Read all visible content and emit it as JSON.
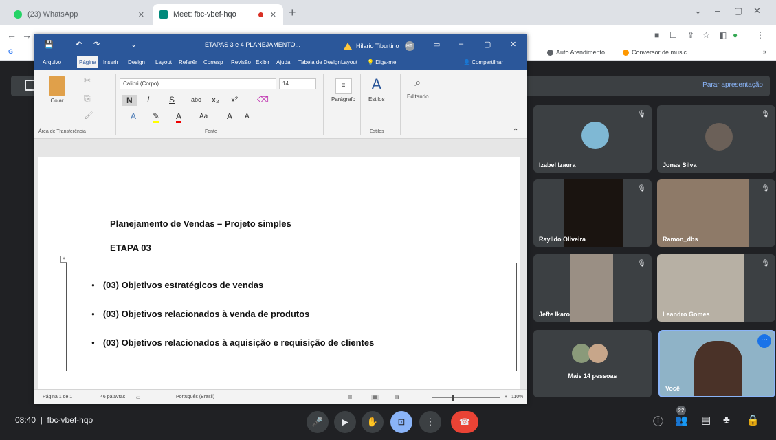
{
  "browser": {
    "tabs": [
      {
        "label": "(23) WhatsApp",
        "favicon_color": "#25d366"
      },
      {
        "label": "Meet: fbc-vbef-hqo",
        "favicon_color": "#00897b"
      }
    ],
    "bookmarks": [
      {
        "label": "Auto Atendimento...",
        "icon_color": "#5f6368"
      },
      {
        "label": "Conversor de music...",
        "icon_color": "#ff9800"
      }
    ]
  },
  "meet": {
    "stop_presenting_label": "Parar apresentação",
    "participants": [
      {
        "name": "Izabel Izaura"
      },
      {
        "name": "Jonas Silva"
      },
      {
        "name": "Raylldo Oliveira"
      },
      {
        "name": "Ramon_dbs"
      },
      {
        "name": "Jefte Ikaro"
      },
      {
        "name": "Leandro Gomes"
      },
      {
        "name": "Mais 14 pessoas"
      },
      {
        "name": "Você"
      }
    ],
    "clock": "08:40",
    "meeting_code": "fbc-vbef-hqo",
    "participant_count": "22"
  },
  "word": {
    "title": "ETAPAS 3 e 4 PLANEJAMENTO...",
    "user_name": "Hilario Tiburtino",
    "user_initials": "HT",
    "menu": [
      "Arquivo",
      "Página",
      "Inserir",
      "Design",
      "Layout",
      "Referêr",
      "Corresp",
      "Revisão",
      "Exibir",
      "Ajuda",
      "Tabela de Design",
      "Layout"
    ],
    "tell_me": "Diga-me",
    "share": "Compartilhar",
    "ribbon": {
      "paste": "Colar",
      "clipboard": "Área de Transferência",
      "font_name": "Calibri (Corpo)",
      "font_size": "14",
      "font_group": "Fonte",
      "bold": "N",
      "italic": "I",
      "underline": "S",
      "strike": "abc",
      "sub": "x₂",
      "sup": "x²",
      "aa": "Aa",
      "paragraph": "Parágrafo",
      "styles": "Estilos",
      "styles_group": "Estilos",
      "editing": "Editando"
    },
    "document": {
      "title": "Planejamento de Vendas – Projeto simples",
      "subtitle": "ETAPA 03",
      "bullets": [
        "(03) Objetivos estratégicos de vendas",
        "(03) Objetivos relacionados à venda de produtos",
        "(03) Objetivos relacionados à aquisição e requisição de clientes"
      ]
    },
    "status": {
      "page": "Página 1 de 1",
      "words": "46 palavras",
      "language": "Português (Brasil)",
      "zoom": "110%"
    }
  }
}
